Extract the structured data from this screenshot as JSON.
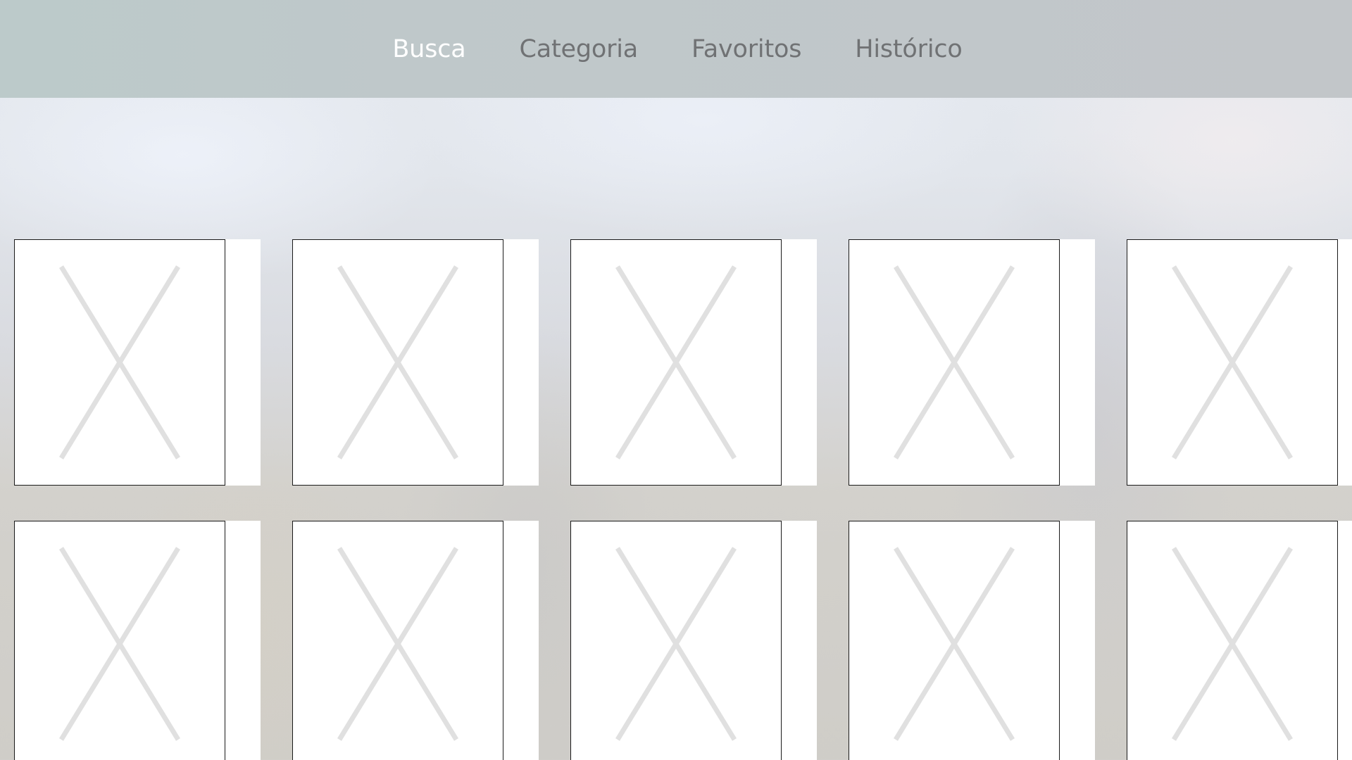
{
  "tab_bar": {
    "tabs": [
      {
        "label": "Busca",
        "active": true
      },
      {
        "label": "Categoria",
        "active": false
      },
      {
        "label": "Favoritos",
        "active": false
      },
      {
        "label": "Histórico",
        "active": false
      }
    ]
  },
  "grid": {
    "items": [
      {
        "placeholder_icon": "broken-image-x-icon"
      },
      {
        "placeholder_icon": "broken-image-x-icon"
      },
      {
        "placeholder_icon": "broken-image-x-icon"
      },
      {
        "placeholder_icon": "broken-image-x-icon"
      },
      {
        "placeholder_icon": "broken-image-x-icon"
      },
      {
        "placeholder_icon": "broken-image-x-icon"
      },
      {
        "placeholder_icon": "broken-image-x-icon"
      },
      {
        "placeholder_icon": "broken-image-x-icon"
      },
      {
        "placeholder_icon": "broken-image-x-icon"
      },
      {
        "placeholder_icon": "broken-image-x-icon"
      }
    ]
  },
  "colors": {
    "tab_active": "#ffffff",
    "tab_inactive": "#707274",
    "tab_bar_bg": "#bfc8ca",
    "placeholder_x": "#e0e0e0"
  }
}
